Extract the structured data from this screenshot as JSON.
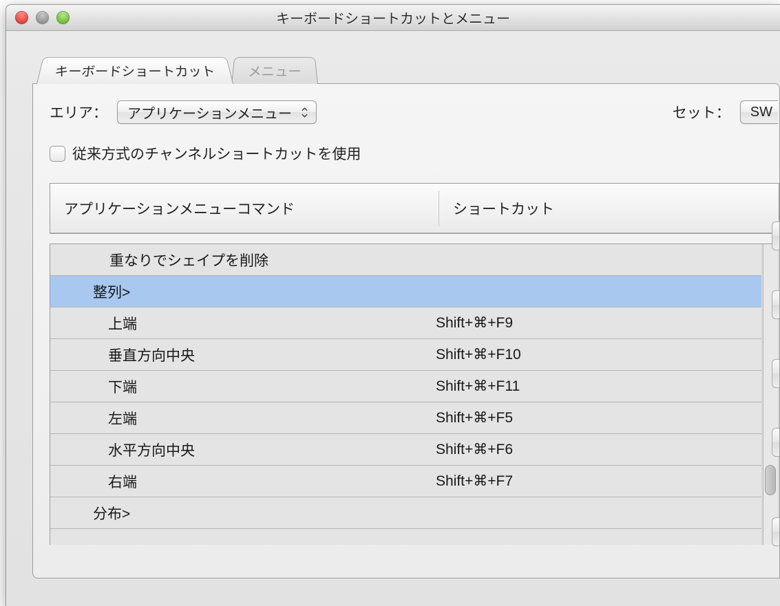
{
  "window": {
    "title": "キーボードショートカットとメニュー"
  },
  "tabs": {
    "shortcuts": "キーボードショートカット",
    "menus": "メニュー"
  },
  "area": {
    "label": "エリア：",
    "value": "アプリケーションメニュー"
  },
  "set": {
    "label": "セット：",
    "value": "SW"
  },
  "legacyCheckbox": {
    "checked": false,
    "label": "従来方式のチャンネルショートカットを使用"
  },
  "columns": {
    "command": "アプリケーションメニューコマンド",
    "shortcut": "ショートカット"
  },
  "rows": [
    {
      "indent": 1,
      "label": "重なりでシェイプを削除",
      "shortcut": "",
      "selected": false
    },
    {
      "indent": 2,
      "label": "整列>",
      "shortcut": "",
      "selected": true
    },
    {
      "indent": 3,
      "label": "上端",
      "shortcut": "Shift+⌘+F9",
      "selected": false
    },
    {
      "indent": 3,
      "label": "垂直方向中央",
      "shortcut": "Shift+⌘+F10",
      "selected": false
    },
    {
      "indent": 3,
      "label": "下端",
      "shortcut": "Shift+⌘+F11",
      "selected": false
    },
    {
      "indent": 3,
      "label": "左端",
      "shortcut": "Shift+⌘+F5",
      "selected": false
    },
    {
      "indent": 3,
      "label": "水平方向中央",
      "shortcut": "Shift+⌘+F6",
      "selected": false
    },
    {
      "indent": 3,
      "label": "右端",
      "shortcut": "Shift+⌘+F7",
      "selected": false
    },
    {
      "indent": 2,
      "label": "分布>",
      "shortcut": "",
      "selected": false
    }
  ]
}
